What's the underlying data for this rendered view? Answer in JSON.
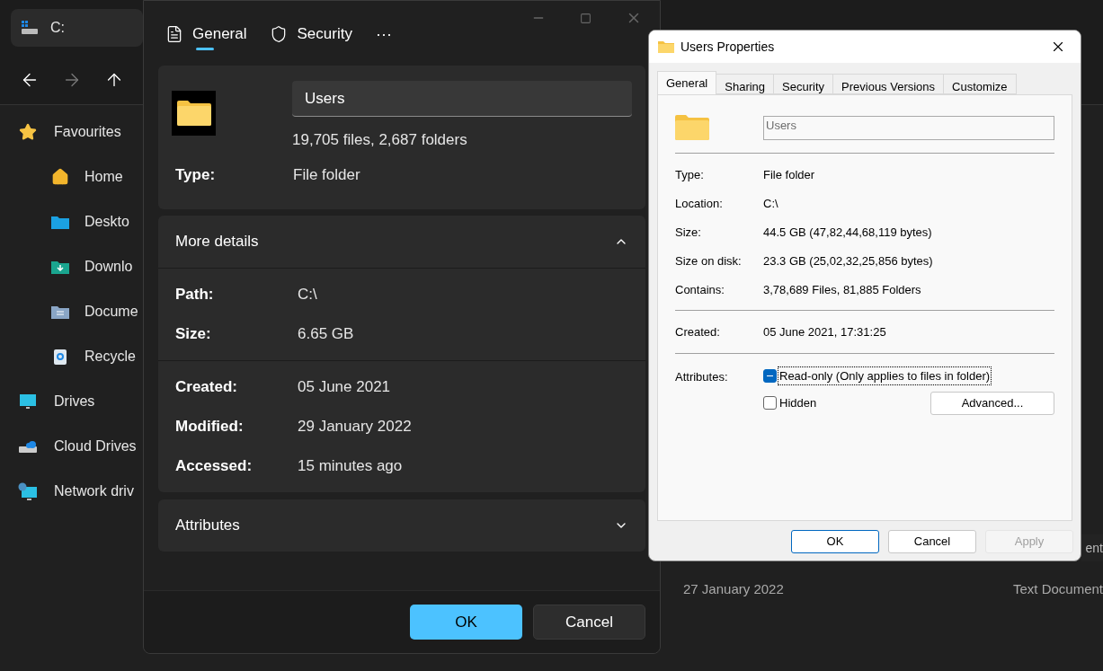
{
  "explorer": {
    "tab": {
      "title": "C:"
    },
    "sidebar": {
      "items": [
        {
          "label": "Favourites",
          "kind": "star",
          "children": [
            {
              "label": "Home",
              "kind": "home"
            },
            {
              "label": "Deskto",
              "kind": "desktop"
            },
            {
              "label": "Downlo",
              "kind": "download"
            },
            {
              "label": "Docume",
              "kind": "documents"
            },
            {
              "label": "Recycle",
              "kind": "recycle"
            }
          ]
        },
        {
          "label": "Drives",
          "kind": "monitor"
        },
        {
          "label": "Cloud Drives",
          "kind": "cloud"
        },
        {
          "label": "Network driv",
          "kind": "network"
        }
      ]
    },
    "file_list": {
      "rows": [
        {
          "text": "ent",
          "selected": false
        },
        {
          "date": "27 January 2022",
          "type": "Text Document",
          "selected": false
        }
      ]
    }
  },
  "modern_dialog": {
    "tabs": [
      {
        "label": "General",
        "kind": "file",
        "selected": true
      },
      {
        "label": "Security",
        "kind": "shield",
        "selected": false
      }
    ],
    "more_tabs": "···",
    "name": "Users",
    "summary": "19,705 files, 2,687 folders",
    "type_row": {
      "label": "Type:",
      "value": "File folder"
    },
    "sections": [
      {
        "title": "More details",
        "expanded": true,
        "groups": [
          [
            {
              "label": "Path:",
              "value": "C:\\"
            },
            {
              "label": "Size:",
              "value": "6.65 GB"
            }
          ],
          [
            {
              "label": "Created:",
              "value": "05 June 2021"
            },
            {
              "label": "Modified:",
              "value": "29 January 2022"
            },
            {
              "label": "Accessed:",
              "value": "15 minutes ago"
            }
          ]
        ]
      },
      {
        "title": "Attributes",
        "expanded": false
      }
    ],
    "buttons": [
      {
        "label": "OK",
        "primary": true
      },
      {
        "label": "Cancel",
        "primary": false
      }
    ]
  },
  "classic_dialog": {
    "title": "Users Properties",
    "tabs": [
      {
        "label": "General",
        "selected": true
      },
      {
        "label": "Sharing",
        "selected": false
      },
      {
        "label": "Security",
        "selected": false
      },
      {
        "label": "Previous Versions",
        "selected": false
      },
      {
        "label": "Customize",
        "selected": false
      }
    ],
    "name": "Users",
    "groups": [
      [
        {
          "label": "Type:",
          "value": "File folder"
        },
        {
          "label": "Location:",
          "value": "C:\\"
        },
        {
          "label": "Size:",
          "value": "44.5 GB (47,82,44,68,119 bytes)"
        },
        {
          "label": "Size on disk:",
          "value": "23.3 GB (25,02,32,25,856 bytes)"
        },
        {
          "label": "Contains:",
          "value": "3,78,689 Files, 81,885 Folders"
        }
      ],
      [
        {
          "label": "Created:",
          "value": "05 June 2021, 17:31:25"
        }
      ]
    ],
    "attributes_label": "Attributes:",
    "attributes": [
      {
        "label": "Read-only (Only applies to files in folder)",
        "mixed": true,
        "focused": true
      },
      {
        "label": "Hidden",
        "checked": false,
        "focused": false
      }
    ],
    "advanced_button": "Advanced...",
    "buttons": [
      {
        "label": "OK",
        "default": true,
        "disabled": false
      },
      {
        "label": "Cancel",
        "default": false,
        "disabled": false
      },
      {
        "label": "Apply",
        "default": false,
        "disabled": true
      }
    ]
  }
}
